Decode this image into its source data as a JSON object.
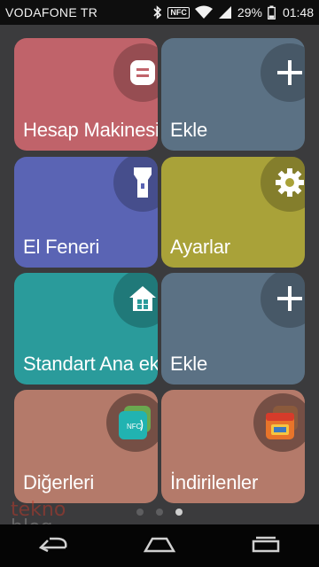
{
  "status_bar": {
    "carrier": "VODAFONE TR",
    "nfc_label": "NFC",
    "battery_percent": "29%",
    "time": "01:48",
    "icons": [
      "bluetooth-icon",
      "nfc-icon",
      "wifi-icon",
      "signal-icon",
      "battery-icon"
    ]
  },
  "tiles": [
    {
      "label": "Hesap Makinesi",
      "icon": "calculator-icon",
      "color": "#c0636a"
    },
    {
      "label": "Ekle",
      "icon": "plus-icon",
      "color": "#5b7184"
    },
    {
      "label": "El Feneri",
      "icon": "flashlight-icon",
      "color": "#5a64b4"
    },
    {
      "label": "Ayarlar",
      "icon": "gear-icon",
      "color": "#a9a239"
    },
    {
      "label": "Standart Ana ekran",
      "icon": "home-icon",
      "color": "#2a9b9b"
    },
    {
      "label": "Ekle",
      "icon": "plus-icon",
      "color": "#5b7184"
    },
    {
      "label": "Diğerleri",
      "icon": "nfc-app-icon",
      "color": "#b47a6a"
    },
    {
      "label": "İndirilenler",
      "icon": "downloaded-app-icon",
      "color": "#b47a6a"
    }
  ],
  "pager": {
    "pages": 3,
    "active_page": 3
  },
  "watermark": {
    "line1": "tekno",
    "line2": "blog"
  },
  "navigation": {
    "buttons": [
      "back-icon",
      "home-nav-icon",
      "recents-icon"
    ]
  }
}
